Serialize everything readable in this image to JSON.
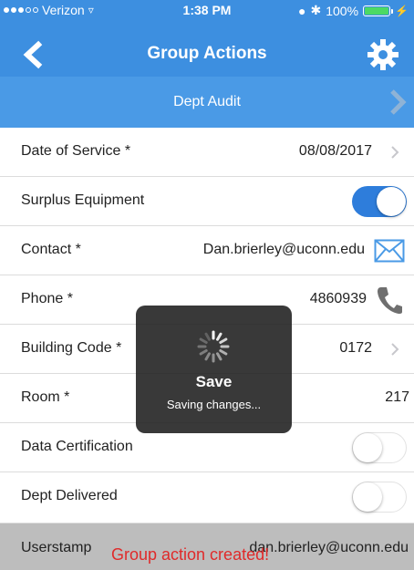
{
  "status_bar": {
    "carrier": "Verizon",
    "time": "1:38 PM",
    "battery": "100%"
  },
  "nav": {
    "title": "Group Actions"
  },
  "subheader": {
    "title": "Dept Audit"
  },
  "rows": [
    {
      "label": "Date of Service *",
      "value": "08/08/2017"
    },
    {
      "label": "Surplus Equipment",
      "toggle": true
    },
    {
      "label": "Contact *",
      "value": "Dan.brierley@uconn.edu"
    },
    {
      "label": "Phone *",
      "value": "4860939"
    },
    {
      "label": "Building Code *",
      "value": "0172"
    },
    {
      "label": "Room *",
      "value": "217"
    },
    {
      "label": "Data Certification",
      "toggle": false
    },
    {
      "label": "Dept Delivered",
      "toggle": false
    }
  ],
  "footer": {
    "label": "Userstamp",
    "value": "dan.brierley@uconn.edu",
    "toast": "Group action created!"
  },
  "hud": {
    "title": "Save",
    "subtitle": "Saving changes..."
  },
  "colors": {
    "nav_bg": "#3d8fe0",
    "subheader_bg": "#4a9ae6",
    "toggle_on": "#2e7ddb",
    "toast_text": "#e02a2a",
    "footer_bg": "#bdbdbd"
  },
  "icons": [
    "back-arrow-icon",
    "gear-icon",
    "chevron-right-icon",
    "mail-icon",
    "phone-icon",
    "spinner-icon",
    "wifi-icon",
    "alarm-icon",
    "bluetooth-icon",
    "battery-icon"
  ]
}
